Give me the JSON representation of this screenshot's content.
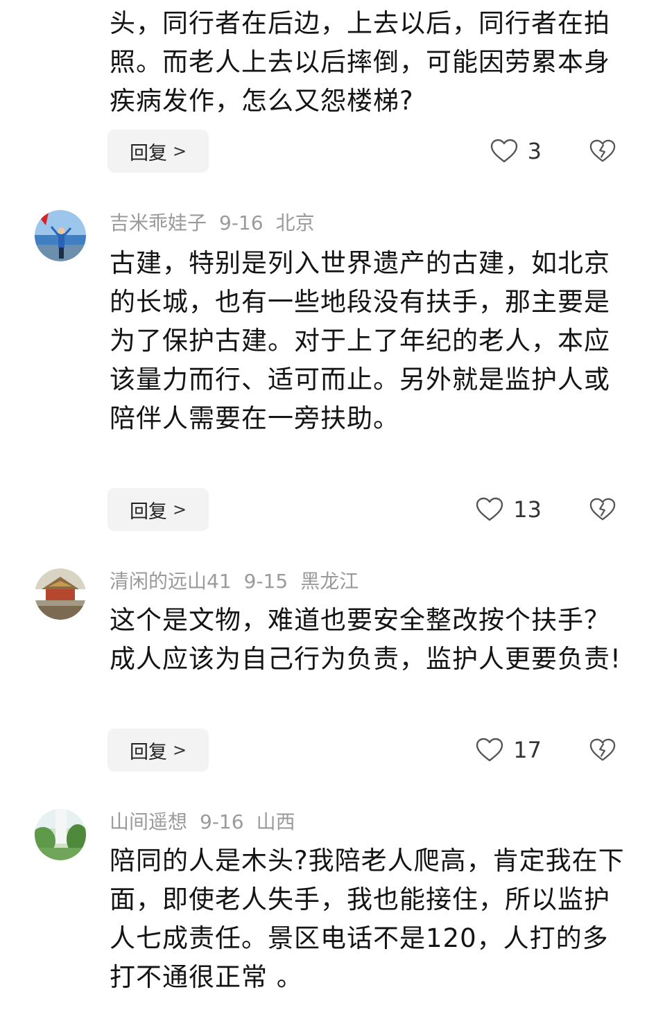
{
  "comments": [
    {
      "user": "",
      "date": "",
      "location": "",
      "text": "头，同行者在后边，上去以后，同行者在拍照。而老人上去以后摔倒，可能因劳累本身疾病发作，怎么又怨楼梯?",
      "reply_label": "回复",
      "likes": "3"
    },
    {
      "user": "吉米乖娃子",
      "date": "9-16",
      "location": "北京",
      "text": "古建，特别是列入世界遗产的古建，如北京的长城，也有一些地段没有扶手，那主要是为了保护古建。对于上了年纪的老人，本应该量力而行、适可而止。另外就是监护人或陪伴人需要在一旁扶助。",
      "reply_label": "回复",
      "likes": "13"
    },
    {
      "user": "清闲的远山41",
      "date": "9-15",
      "location": "黑龙江",
      "text": "这个是文物，难道也要安全整改按个扶手？成人应该为自己行为负责，监护人更要负责!",
      "reply_label": "回复",
      "likes": "17"
    },
    {
      "user": "山间遥想",
      "date": "9-16",
      "location": "山西",
      "text": "陪同的人是木头?我陪老人爬高，肯定我在下面，即使老人失手，我也能接住，所以监护人七成责任。景区电话不是120，人打的多打不通很正常 。",
      "reply_label": "回复",
      "likes": ""
    }
  ],
  "icons": {
    "reply_chevron": "chevron-right-icon",
    "like": "heart-outline-icon",
    "dislike": "broken-heart-icon"
  },
  "colors": {
    "meta_text": "#9a9a9a",
    "reply_bg": "#f3f3f3",
    "body_text": "#141414"
  }
}
